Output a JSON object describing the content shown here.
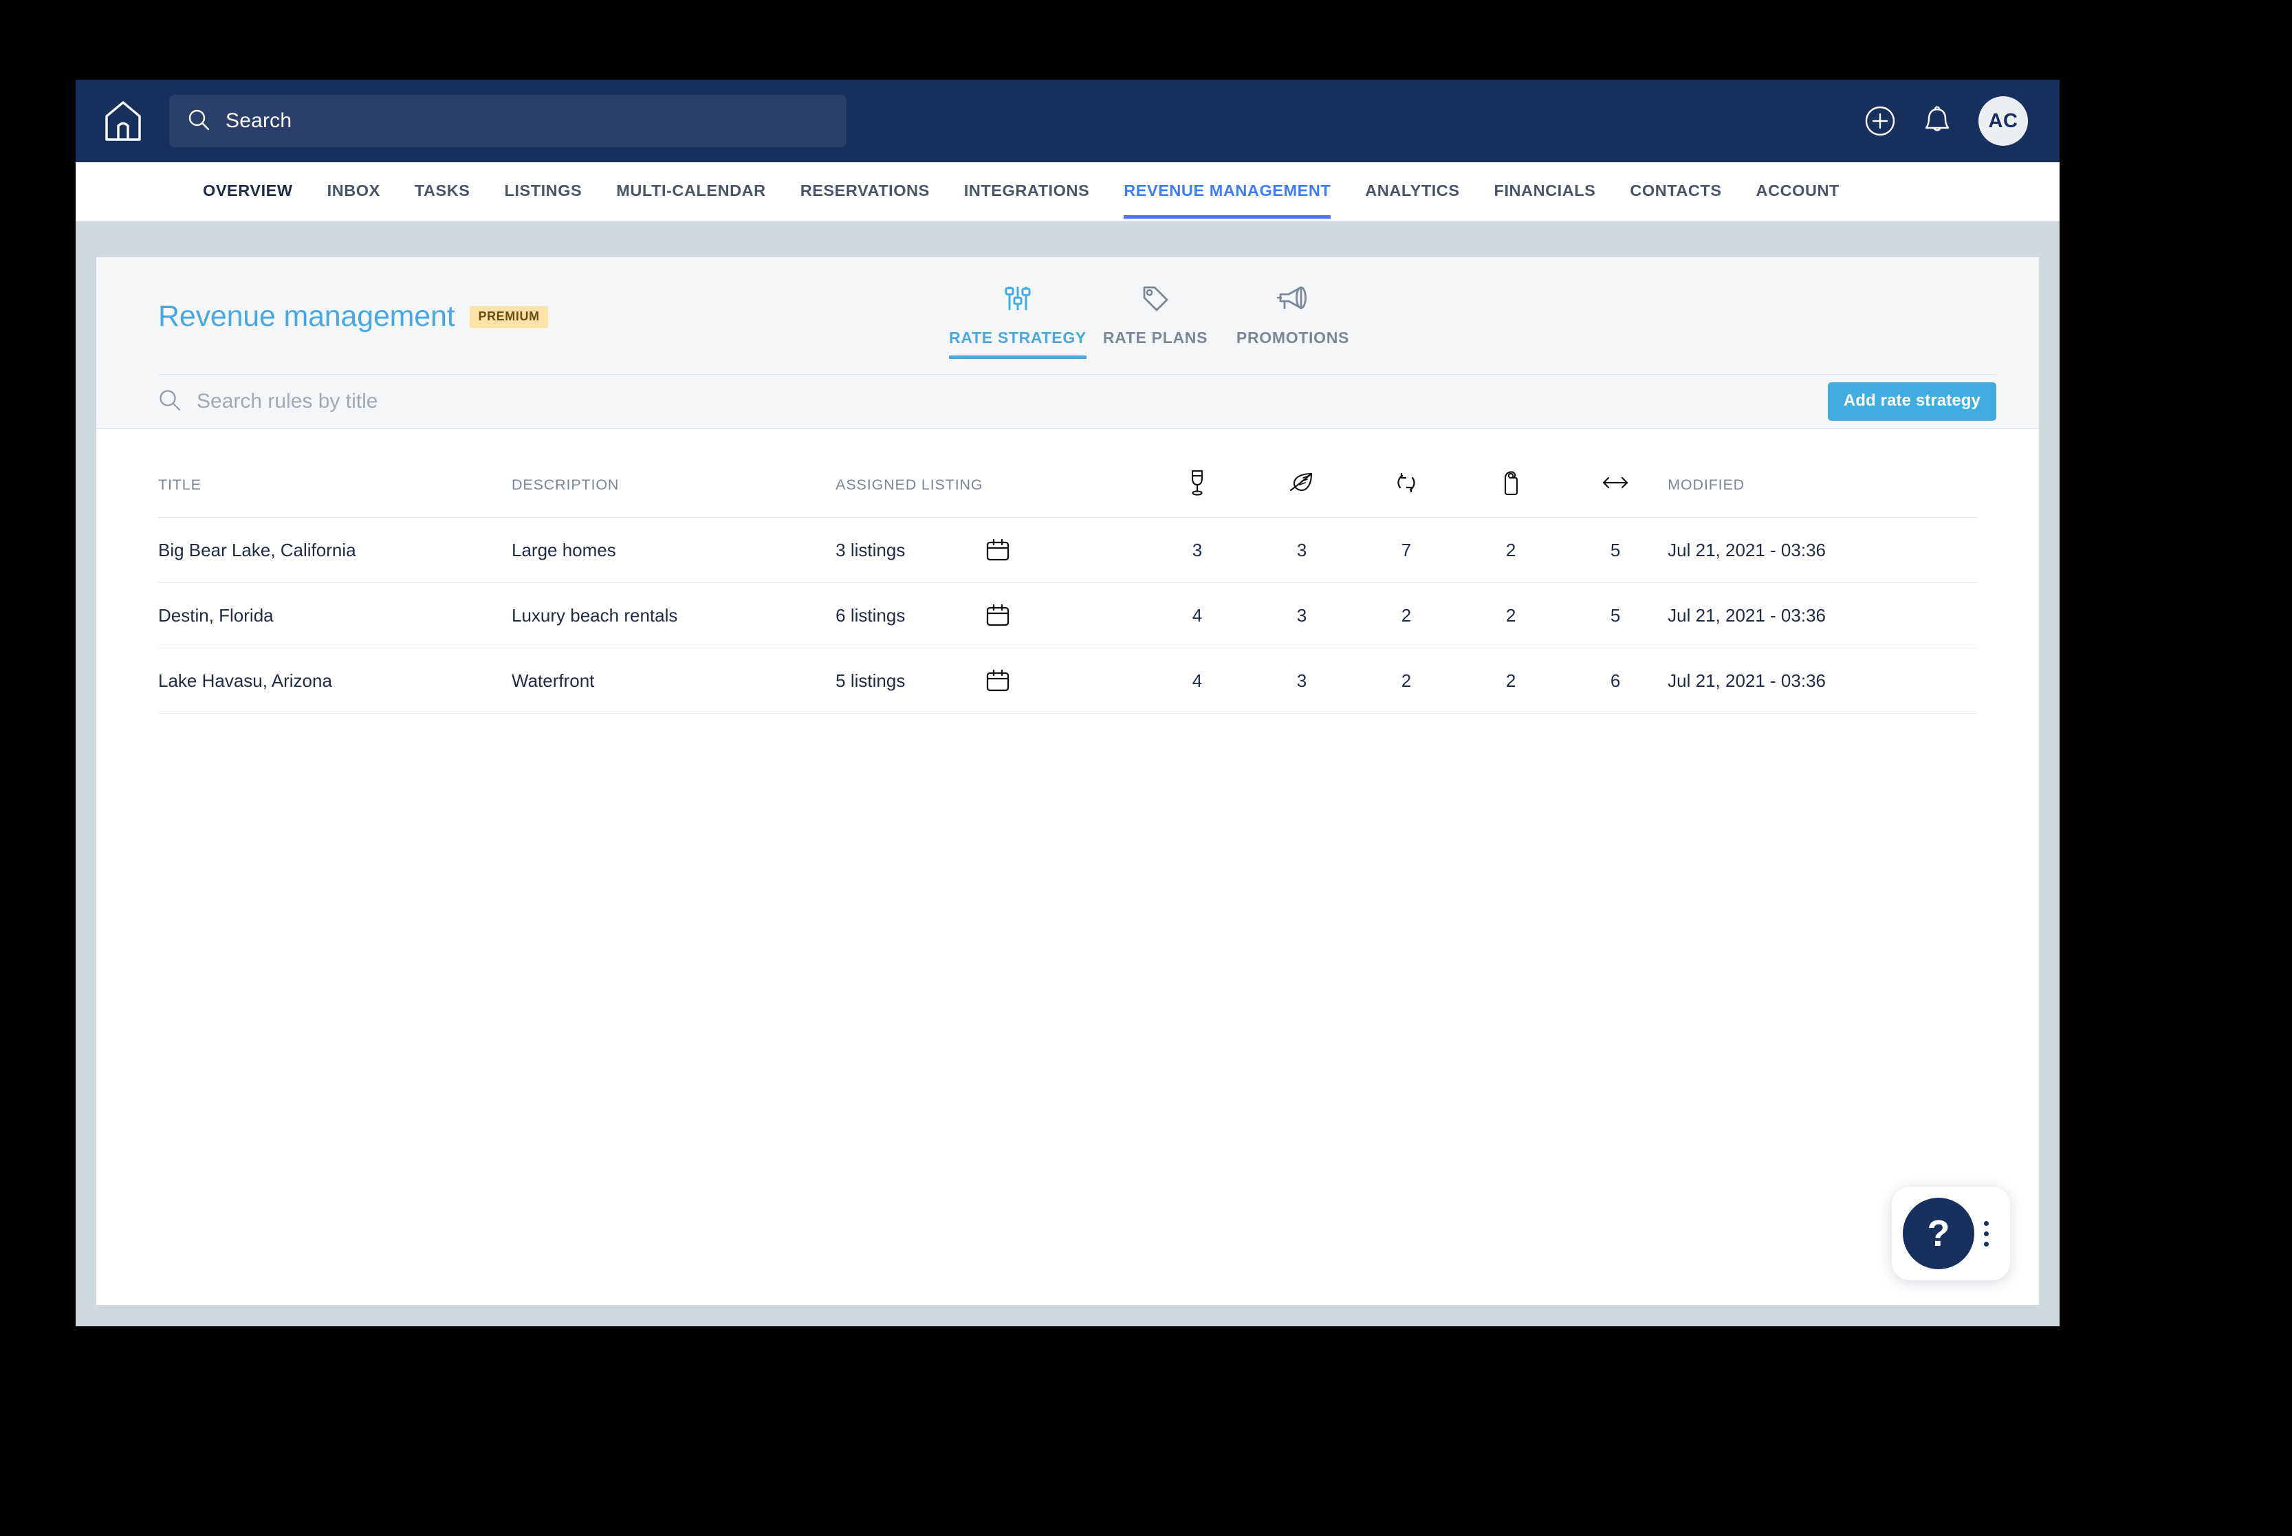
{
  "topbar": {
    "logo_icon": "home-icon",
    "search": {
      "placeholder": "Search",
      "value": "",
      "icon": "search-icon"
    },
    "add_icon": "plus-circle-icon",
    "notifications_icon": "bell-icon",
    "avatar_initials": "AC",
    "background_color": "#17305e"
  },
  "nav": {
    "items": [
      {
        "label": "OVERVIEW",
        "active": false,
        "emphasis": true
      },
      {
        "label": "INBOX",
        "active": false
      },
      {
        "label": "TASKS",
        "active": false
      },
      {
        "label": "LISTINGS",
        "active": false
      },
      {
        "label": "MULTI-CALENDAR",
        "active": false
      },
      {
        "label": "RESERVATIONS",
        "active": false
      },
      {
        "label": "INTEGRATIONS",
        "active": false
      },
      {
        "label": "REVENUE MANAGEMENT",
        "active": true
      },
      {
        "label": "ANALYTICS",
        "active": false
      },
      {
        "label": "FINANCIALS",
        "active": false
      },
      {
        "label": "CONTACTS",
        "active": false
      },
      {
        "label": "ACCOUNT",
        "active": false
      }
    ],
    "active_color": "#3d7dfd"
  },
  "page": {
    "title": "Revenue management",
    "title_color": "#4aa8e0",
    "badge": "PREMIUM",
    "badge_bg": "#fde3a7"
  },
  "subtabs": [
    {
      "label": "RATE STRATEGY",
      "icon": "sliders-icon",
      "active": true
    },
    {
      "label": "RATE PLANS",
      "icon": "tag-icon",
      "active": false
    },
    {
      "label": "PROMOTIONS",
      "icon": "megaphone-icon",
      "active": false
    }
  ],
  "toolbar": {
    "search_placeholder": "Search rules by title",
    "search_value": "",
    "search_icon": "search-icon",
    "add_button_label": "Add rate strategy",
    "add_button_color": "#41ace0"
  },
  "table": {
    "headers": {
      "title": "TITLE",
      "description": "DESCRIPTION",
      "assigned_listing": "ASSIGNED LISTING",
      "modified": "MODIFIED"
    },
    "icon_headers": [
      {
        "name": "champagne-glass-icon",
        "meaning": "high-season"
      },
      {
        "name": "leaf-icon",
        "meaning": "low-season"
      },
      {
        "name": "refresh-cycle-icon",
        "meaning": "turnover"
      },
      {
        "name": "door-hanger-icon",
        "meaning": "occupancy"
      },
      {
        "name": "left-right-arrow-icon",
        "meaning": "length-of-stay"
      }
    ],
    "rows": [
      {
        "title": "Big Bear Lake, California",
        "description": "Large homes",
        "assigned_listing": "3 listings",
        "calendar_icon": "calendar-icon",
        "m1": "3",
        "m2": "3",
        "m3": "7",
        "m4": "2",
        "m5": "5",
        "modified": "Jul 21, 2021 - 03:36"
      },
      {
        "title": "Destin, Florida",
        "description": "Luxury beach rentals",
        "assigned_listing": "6 listings",
        "calendar_icon": "calendar-icon",
        "m1": "4",
        "m2": "3",
        "m3": "2",
        "m4": "2",
        "m5": "5",
        "modified": "Jul 21, 2021 - 03:36"
      },
      {
        "title": "Lake Havasu, Arizona",
        "description": "Waterfront",
        "assigned_listing": "5 listings",
        "calendar_icon": "calendar-icon",
        "m1": "4",
        "m2": "3",
        "m3": "2",
        "m4": "2",
        "m5": "6",
        "modified": "Jul 21, 2021 - 03:36"
      }
    ]
  },
  "help": {
    "fab_label": "?",
    "fab_color": "#17305e",
    "menu_icon": "kebab-menu-icon"
  }
}
